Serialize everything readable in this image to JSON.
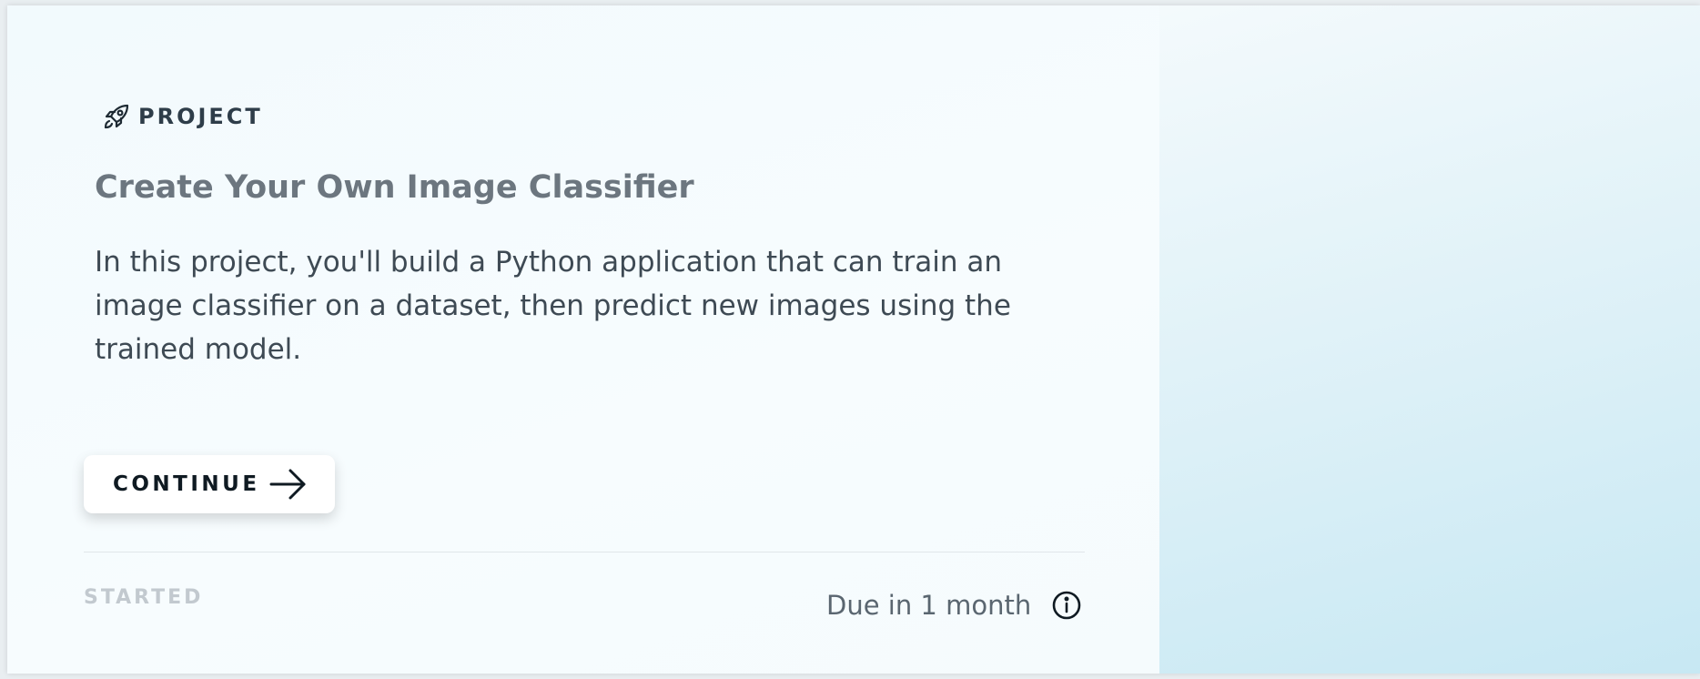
{
  "card": {
    "kicker": {
      "icon": "rocket-icon",
      "label": "PROJECT"
    },
    "title": "Create Your Own Image Classifier",
    "summary": "In this project, you'll build a Python application that can train an image classifier on a dataset, then predict new images using the trained model.",
    "continue_button": {
      "label": "CONTINUE",
      "icon": "arrow-right-icon"
    },
    "status": "STARTED",
    "due": "Due in 1 month",
    "info_icon": "info-icon"
  },
  "illustration": {
    "name": "image-classifier-illustration",
    "colors": {
      "outline": "#4a4f55",
      "blue_flower": "#4ba3cf",
      "yellow_flower": "#f0b437",
      "layer_fill": "#d7dde3",
      "dots": "#3aa0d8",
      "connectors": "#8a97a3"
    }
  },
  "colors": {
    "card_bg": "#f5fbfd",
    "panel_bg": "#c7e8f3",
    "title": "#6c767f",
    "text": "#3e4a54",
    "muted": "#c2c9cf"
  }
}
